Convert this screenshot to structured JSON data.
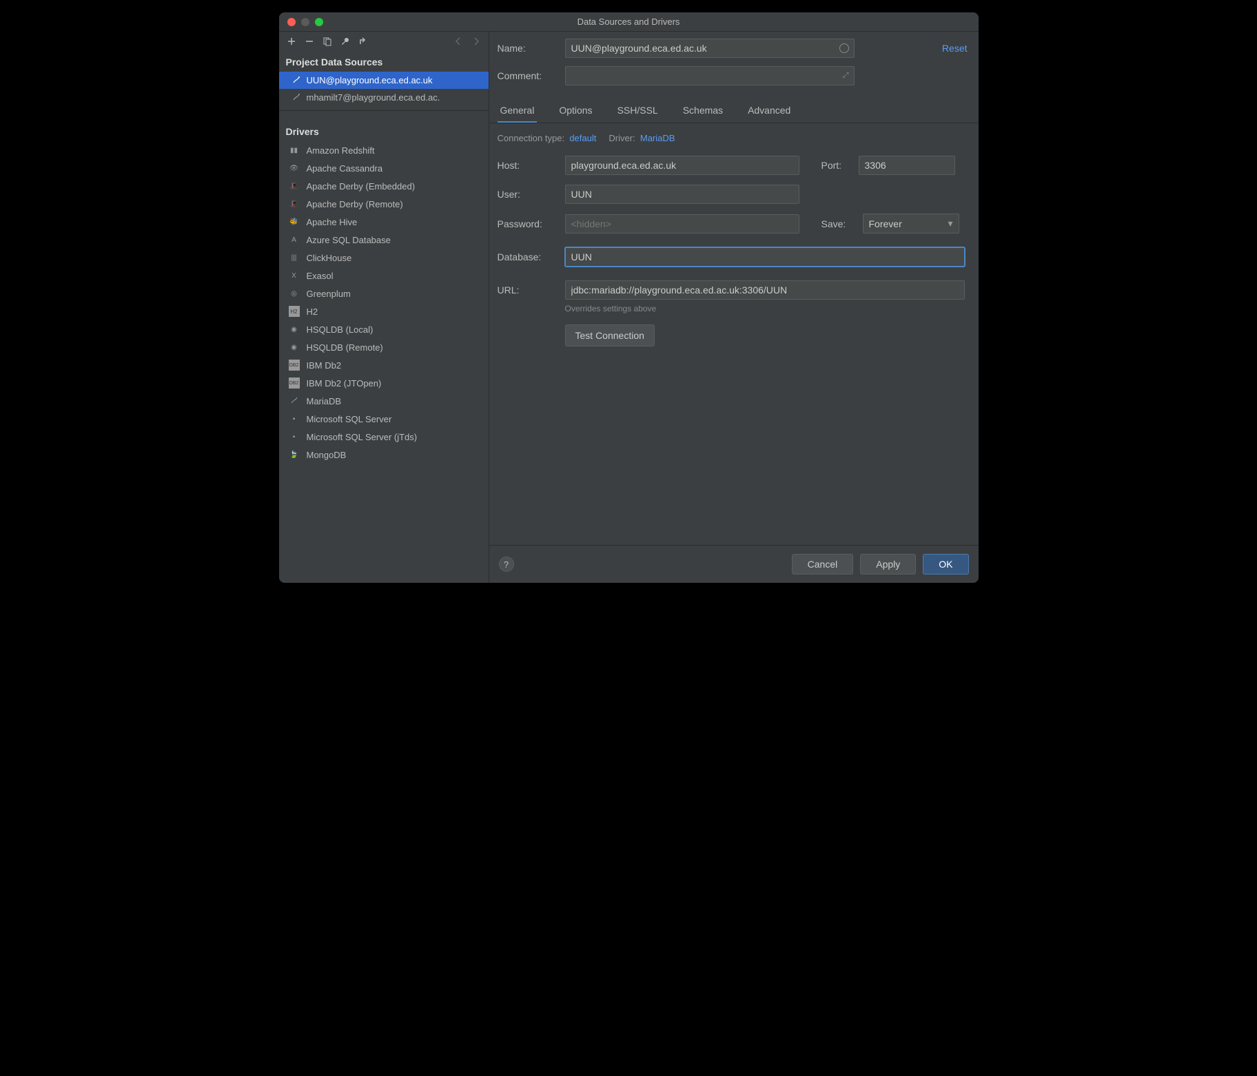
{
  "window": {
    "title": "Data Sources and Drivers"
  },
  "sidebar": {
    "section1": "Project Data Sources",
    "dataSources": [
      {
        "label": "UUN@playground.eca.ed.ac.uk",
        "selected": true
      },
      {
        "label": "mhamilt7@playground.eca.ed.ac.",
        "selected": false
      }
    ],
    "section2": "Drivers",
    "drivers": [
      "Amazon Redshift",
      "Apache Cassandra",
      "Apache Derby (Embedded)",
      "Apache Derby (Remote)",
      "Apache Hive",
      "Azure SQL Database",
      "ClickHouse",
      "Exasol",
      "Greenplum",
      "H2",
      "HSQLDB (Local)",
      "HSQLDB (Remote)",
      "IBM Db2",
      "IBM Db2 (JTOpen)",
      "MariaDB",
      "Microsoft SQL Server",
      "Microsoft SQL Server (jTds)",
      "MongoDB"
    ]
  },
  "form": {
    "nameLabel": "Name:",
    "nameValue": "UUN@playground.eca.ed.ac.uk",
    "resetLabel": "Reset",
    "commentLabel": "Comment:",
    "commentValue": ""
  },
  "tabs": [
    "General",
    "Options",
    "SSH/SSL",
    "Schemas",
    "Advanced"
  ],
  "general": {
    "connTypeLabel": "Connection type:",
    "connTypeValue": "default",
    "driverLabel": "Driver:",
    "driverValue": "MariaDB",
    "hostLabel": "Host:",
    "hostValue": "playground.eca.ed.ac.uk",
    "portLabel": "Port:",
    "portValue": "3306",
    "userLabel": "User:",
    "userValue": "UUN",
    "passwordLabel": "Password:",
    "passwordPlaceholder": "<hidden>",
    "saveLabel": "Save:",
    "saveValue": "Forever",
    "databaseLabel": "Database:",
    "databaseValue": "UUN",
    "urlLabel": "URL:",
    "urlValue": "jdbc:mariadb://playground.eca.ed.ac.uk:3306/UUN",
    "urlHint": "Overrides settings above",
    "testButton": "Test Connection"
  },
  "footer": {
    "cancel": "Cancel",
    "apply": "Apply",
    "ok": "OK"
  }
}
